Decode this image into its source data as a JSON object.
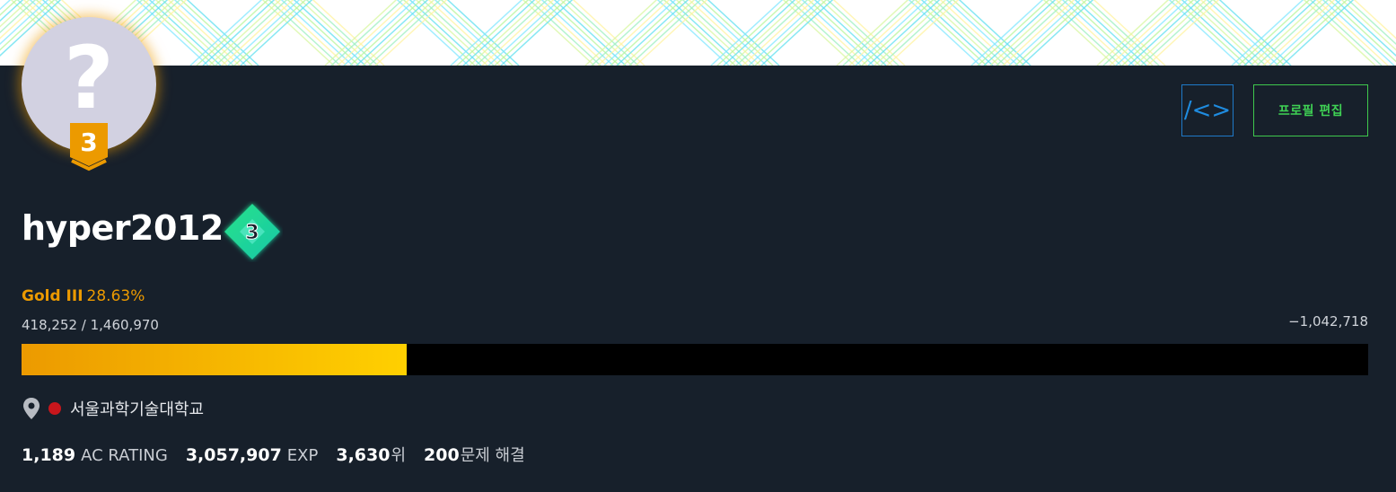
{
  "profile": {
    "username": "hyper2012",
    "avatar_placeholder": "?",
    "tier_badge_level": "3",
    "class_badge_level": "3"
  },
  "actions": {
    "code_button_label": "/<>",
    "edit_profile_label": "프로필 편집"
  },
  "tier": {
    "name": "Gold III",
    "percent_text": "28.63%",
    "progress_fraction": 0.2863,
    "current_vs_next": "418,252 / 1,460,970",
    "remaining": "−1,042,718"
  },
  "organization": {
    "name": "서울과학기술대학교",
    "dot_color": "#c8161c"
  },
  "stats": [
    {
      "value": "1,189",
      "label": "AC RATING"
    },
    {
      "value": "3,057,907",
      "label": "EXP"
    },
    {
      "value": "3,630",
      "label": "위"
    },
    {
      "value": "200",
      "label": "문제 해결"
    }
  ],
  "colors": {
    "background": "#17202b",
    "gold": "#ec9a00",
    "gold_light": "#ffd000",
    "code_button": "#1f8ce0",
    "edit_button": "#3fd154"
  }
}
